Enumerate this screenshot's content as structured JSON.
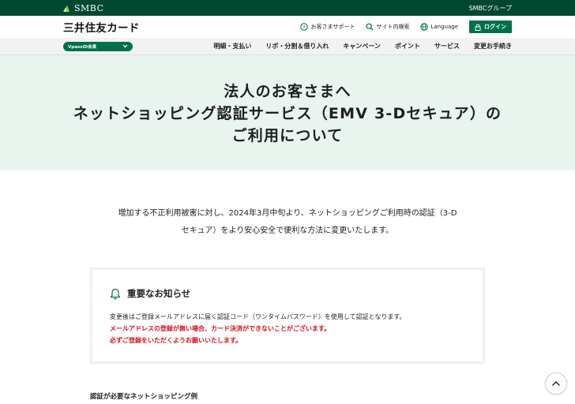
{
  "topbar": {
    "smbc": "SMBC",
    "group": "SMBCグループ"
  },
  "header": {
    "brand": "三井住友カード",
    "support": "お客さまサポート",
    "sitesearch": "サイト内検索",
    "language": "Language",
    "login": "ログイン"
  },
  "nav": {
    "member": "VpassID会員",
    "items": [
      "明細・支払い",
      "リボ・分割＆借り入れ",
      "キャンペーン",
      "ポイント",
      "サービス",
      "変更お手続き"
    ]
  },
  "hero": {
    "line1": "法人のお客さまへ",
    "line2": "ネットショッピング認証サービス（EMV 3-Dセキュア）の",
    "line3": "ご利用について"
  },
  "intro": {
    "line1": "増加する不正利用被害に対し、2024年3月中旬より、ネットショッピングご利用時の認証（3-D",
    "line2": "セキュア）をより安心安全で便利な方法に変更いたします。"
  },
  "notice": {
    "title": "重要なお知らせ",
    "line1": "変更後はご登録メールアドレスに届く認証コード（ワンタイムパスワード）を使用して認証となります。",
    "line2": "メールアドレスの登録が無い場合、カード決済ができないことがございます。",
    "line3": "必ずご登録をいただくようお願いいたします。"
  },
  "examples": {
    "title": "認証が必要なネットショッピング例"
  },
  "colors": {
    "brand_green": "#004831",
    "accent_green": "#00704a",
    "hero_bg": "#e9f4ef",
    "alert_red": "#d9121b"
  }
}
